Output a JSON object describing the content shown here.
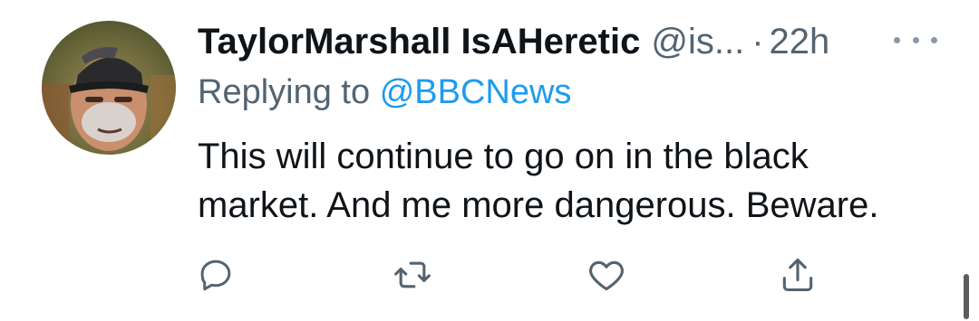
{
  "tweet": {
    "display_name": "TaylorMarshall IsAHeretic",
    "handle": "@is...",
    "separator": "·",
    "time": "22h",
    "replying_prefix": "Replying to",
    "replying_mention": "@BBCNews",
    "text_line_1": "This will continue to go on in the black",
    "text_line_2": "market. And me more dangerous. Beware."
  },
  "actions": {
    "reply_icon": "reply-icon",
    "retweet_icon": "retweet-icon",
    "like_icon": "heart-icon",
    "share_icon": "share-icon"
  },
  "colors": {
    "text_primary": "#0f1419",
    "text_secondary": "#536471",
    "mention": "#1d9bf0"
  }
}
